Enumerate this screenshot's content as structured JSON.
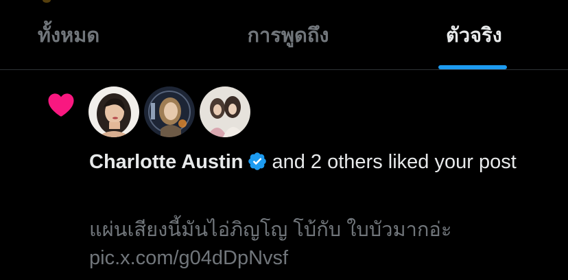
{
  "tabs": [
    {
      "label": "ทั้งหมด",
      "active": false
    },
    {
      "label": "การพูดถึง",
      "active": false
    },
    {
      "label": "ตัวจริง",
      "active": true
    }
  ],
  "notification": {
    "icon": "heart-icon",
    "icon_color": "#f91880",
    "avatars": [
      "avatar-charlotte-austin",
      "avatar-user-2",
      "avatar-user-3"
    ],
    "actor_name": "Charlotte Austin",
    "verified_badge": "verified-badge-icon",
    "verified_color": "#1d9bf0",
    "action_text": "and 2 others liked your post",
    "post_preview": "แผ่นเสียงนี้มันไอ่ภิญโญ โบ้กับ ใบบัวมากอ่ะ pic.x.com/g04dDpNvsf"
  },
  "colors": {
    "background": "#000000",
    "text_primary": "#e7e9ea",
    "text_secondary": "#71767b",
    "accent": "#1d9bf0",
    "divider": "#2f3336"
  }
}
